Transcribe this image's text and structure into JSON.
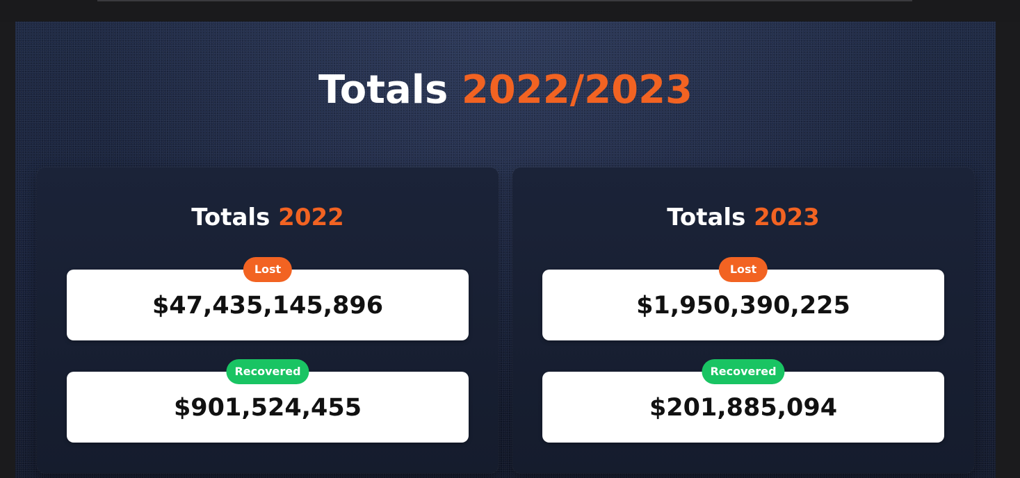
{
  "heading": {
    "prefix": "Totals",
    "years": "2022/2023"
  },
  "colors": {
    "accent": "#f26322",
    "lost_badge": "#f26322",
    "recovered_badge": "#19c463",
    "background": "#1b2540"
  },
  "panels": [
    {
      "title_prefix": "Totals",
      "year": "2022",
      "lost_label": "Lost",
      "lost_value": "$47,435,145,896",
      "recovered_label": "Recovered",
      "recovered_value": "$901,524,455"
    },
    {
      "title_prefix": "Totals",
      "year": "2023",
      "lost_label": "Lost",
      "lost_value": "$1,950,390,225",
      "recovered_label": "Recovered",
      "recovered_value": "$201,885,094"
    }
  ]
}
